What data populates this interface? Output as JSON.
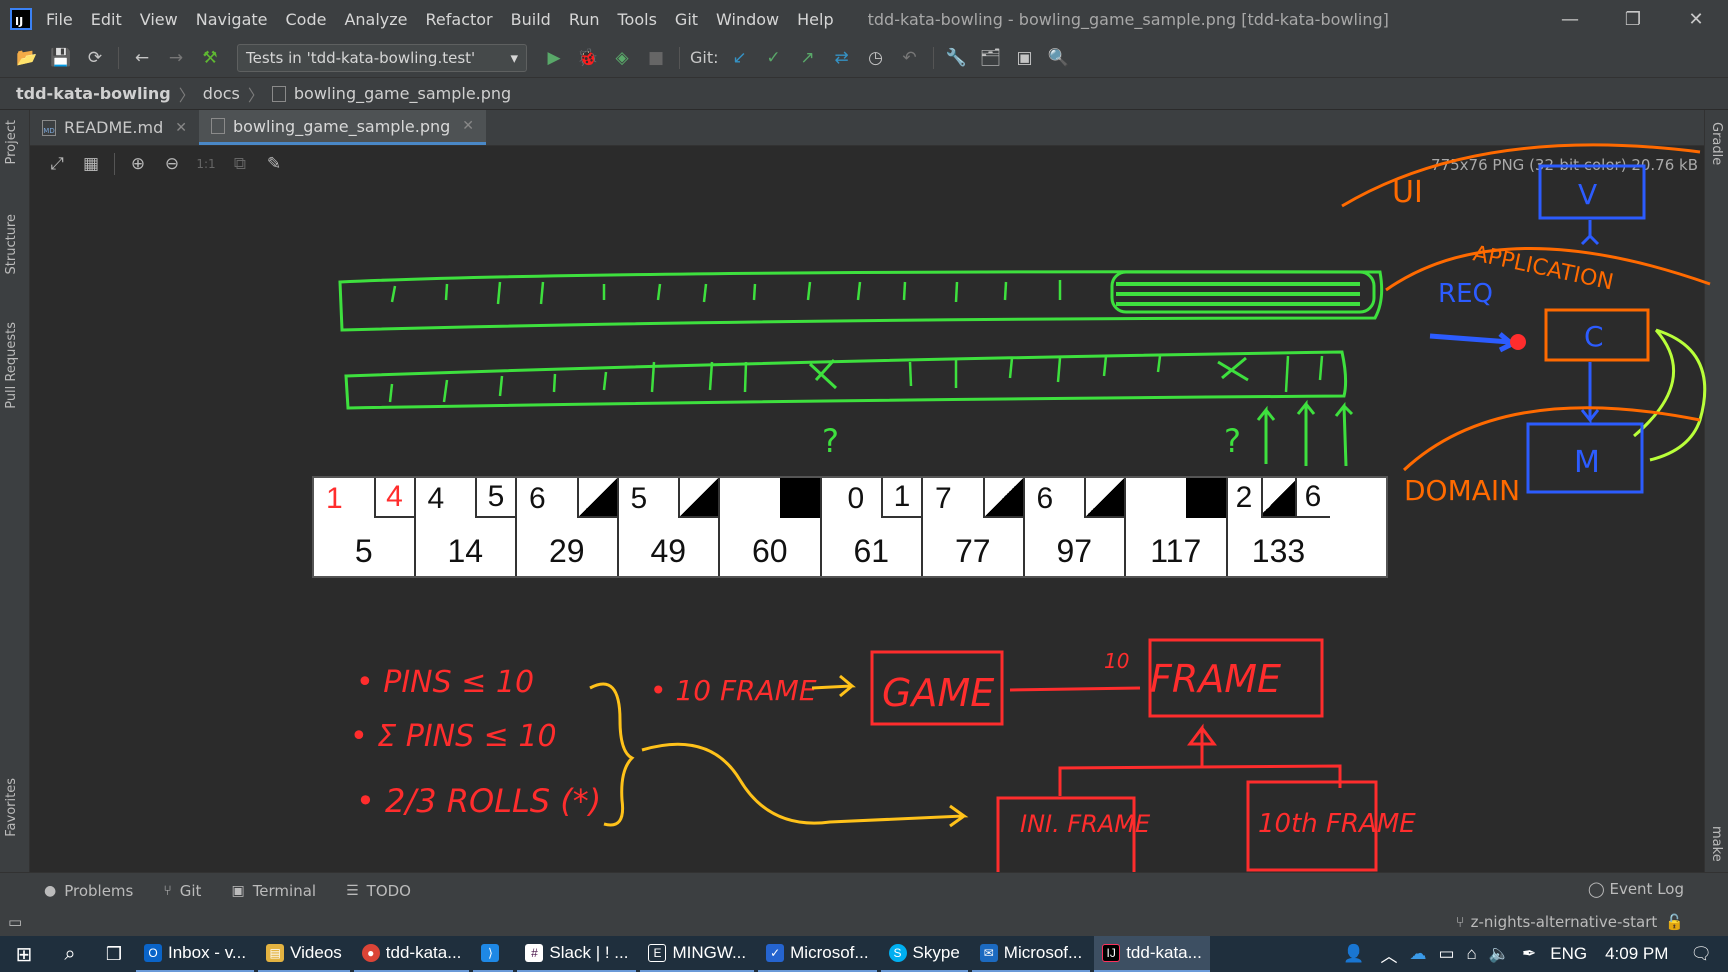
{
  "window": {
    "title": "tdd-kata-bowling - bowling_game_sample.png [tdd-kata-bowling]",
    "menu": [
      "File",
      "Edit",
      "View",
      "Navigate",
      "Code",
      "Analyze",
      "Refactor",
      "Build",
      "Run",
      "Tools",
      "Git",
      "Window",
      "Help"
    ]
  },
  "toolbar": {
    "run_config": "Tests in 'tdd-kata-bowling.test'",
    "git_label": "Git:"
  },
  "breadcrumbs": [
    "tdd-kata-bowling",
    "docs",
    "bowling_game_sample.png"
  ],
  "tabs": [
    {
      "label": "README.md",
      "active": false
    },
    {
      "label": "bowling_game_sample.png",
      "active": true
    }
  ],
  "viewer": {
    "zoom_actual": "1:1",
    "image_info": "775x76 PNG (32-bit color) 20.76 kB"
  },
  "side_tabs": {
    "left": [
      "Project",
      "Structure",
      "Pull Requests",
      "Favorites"
    ],
    "right": [
      "Gradle",
      "make"
    ]
  },
  "scorecard": {
    "frames": [
      {
        "first": "1",
        "second": "4",
        "total": "5",
        "type": "open"
      },
      {
        "first": "4",
        "second": "5",
        "total": "14",
        "type": "open"
      },
      {
        "first": "6",
        "second": "",
        "total": "29",
        "type": "spare"
      },
      {
        "first": "5",
        "second": "",
        "total": "49",
        "type": "spare"
      },
      {
        "first": "",
        "second": "",
        "total": "60",
        "type": "strike"
      },
      {
        "first": "0",
        "second": "1",
        "total": "61",
        "type": "open"
      },
      {
        "first": "7",
        "second": "",
        "total": "77",
        "type": "spare"
      },
      {
        "first": "6",
        "second": "",
        "total": "97",
        "type": "spare"
      },
      {
        "first": "",
        "second": "",
        "total": "117",
        "type": "strike"
      }
    ],
    "tenth": {
      "b1": "2",
      "b3": "6",
      "total": "133"
    }
  },
  "annotations": {
    "rules": [
      "• PINS ≤ 10",
      "• Σ PINS ≤ 10",
      "• 2/3 ROLLS (*)"
    ],
    "ten_frame": "• 10 FRAME",
    "game": "GAME",
    "frame": "FRAME",
    "ten": "10",
    "ini_frame": "INI. FRAME",
    "tenth_frame": "10th FRAME",
    "ui": "UI",
    "v": "V",
    "application": "APPLICATION",
    "req": "REQ",
    "c": "C",
    "domain": "DOMAIN",
    "m": "M",
    "q1": "?",
    "q2": "?"
  },
  "bottom_tools": [
    "Problems",
    "Git",
    "Terminal",
    "TODO"
  ],
  "event_log": "Event Log",
  "branch": "z-nights-alternative-start",
  "taskbar": {
    "items": [
      "Inbox - v...",
      "Videos",
      "tdd-kata...",
      "",
      "Slack | ! ...",
      "MINGW...",
      "Microsof...",
      "Skype",
      "Microsof...",
      "tdd-kata..."
    ],
    "lang": "ENG",
    "time": "4:09 PM"
  },
  "colors": {
    "accent": "#4a88c7",
    "ink_red": "#ff2d2d",
    "ink_green": "#3ee03e",
    "ink_orange": "#ff6a00",
    "ink_blue": "#2c5cff",
    "ink_yellow": "#ffc21a"
  }
}
